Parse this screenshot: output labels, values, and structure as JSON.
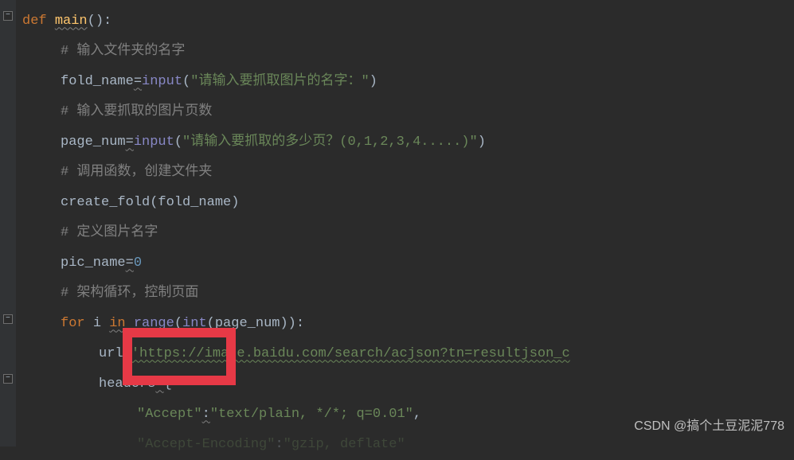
{
  "code": {
    "line1_def": "def",
    "line1_func": "main",
    "line1_parens": "():",
    "line2_comment": "# 输入文件夹的名字",
    "line3_var": "fold_name",
    "line3_eq": "=",
    "line3_builtin": "input",
    "line3_open": "(",
    "line3_string": "\"请输入要抓取图片的名字：\"",
    "line3_close": ")",
    "line4_comment": "# 输入要抓取的图片页数",
    "line5_var": "page_num",
    "line5_eq": "=",
    "line5_builtin": "input",
    "line5_open": "(",
    "line5_string": "\"请输入要抓取的多少页？(0,1,2,3,4.....)\"",
    "line5_close": ")",
    "line6_comment": "# 调用函数，创建文件夹",
    "line7_func": "create_fold",
    "line7_open": "(",
    "line7_arg": "fold_name",
    "line7_close": ")",
    "line8_comment": "# 定义图片名字",
    "line9_var": "pic_name",
    "line9_eq": "=",
    "line9_num": "0",
    "line10_comment": "# 架构循环，控制页面",
    "line11_for": "for",
    "line11_i": "i",
    "line11_in": "in",
    "line11_range": "range",
    "line11_open": "(",
    "line11_int": "int",
    "line11_open2": "(",
    "line11_arg": "page_num",
    "line11_close": ")):",
    "line12_var": "url",
    "line12_eq": "=",
    "line12_string": "'https://image.baidu.com/search/acjson?tn=resultjson_c",
    "line13_var": "headers",
    "line13_eq": "=",
    "line13_brace": "{",
    "line14_key": "\"Accept\"",
    "line14_colon": ":",
    "line14_val": "\"text/plain, */*; q=0.01\"",
    "line14_comma": ",",
    "line15_key": "\"Accept-Encoding\"",
    "line15_colon": ":",
    "line15_val": "\"gzip, deflate\""
  },
  "watermark": "CSDN @搞个土豆泥泥778"
}
